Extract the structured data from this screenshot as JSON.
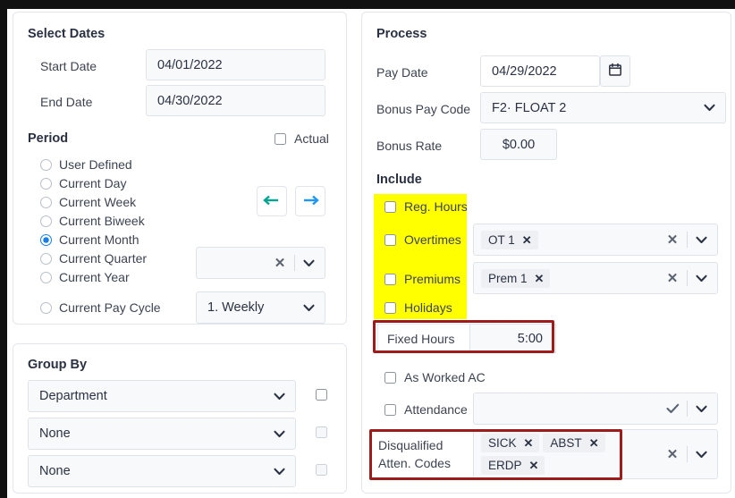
{
  "left": {
    "select_dates": {
      "title": "Select Dates",
      "start_date": {
        "label": "Start Date",
        "value": "04/01/2022"
      },
      "end_date": {
        "label": "End Date",
        "value": "04/30/2022"
      },
      "period": {
        "title": "Period",
        "actual": {
          "label": "Actual",
          "checked": false
        },
        "options": [
          {
            "label": "User Defined",
            "selected": false
          },
          {
            "label": "Current Day",
            "selected": false
          },
          {
            "label": "Current Week",
            "selected": false
          },
          {
            "label": "Current Biweek",
            "selected": false
          },
          {
            "label": "Current Month",
            "selected": true
          },
          {
            "label": "Current Quarter",
            "selected": false
          },
          {
            "label": "Current Year",
            "selected": false
          },
          {
            "label": "Current Pay Cycle",
            "selected": false
          }
        ],
        "nav": {
          "prev_icon": "arrow-left-icon",
          "next_icon": "arrow-right-icon"
        },
        "quarter_select": {
          "value": ""
        },
        "pay_cycle_select": {
          "value": "1. Weekly"
        }
      }
    },
    "group_by": {
      "title": "Group By",
      "rows": [
        {
          "value": "Department",
          "checked": false,
          "disabled": false
        },
        {
          "value": "None",
          "checked": false,
          "disabled": true
        },
        {
          "value": "None",
          "checked": false,
          "disabled": true
        }
      ]
    }
  },
  "right": {
    "process": {
      "title": "Process",
      "pay_date": {
        "label": "Pay Date",
        "value": "04/29/2022",
        "icon": "calendar-icon"
      },
      "bonus_pay_code": {
        "label": "Bonus Pay Code",
        "value": "F2· FLOAT 2"
      },
      "bonus_rate": {
        "label": "Bonus Rate",
        "value": "$0.00"
      },
      "include": {
        "title": "Include",
        "items": [
          {
            "label": "Reg. Hours",
            "checked": false
          },
          {
            "label": "Overtimes",
            "checked": false
          },
          {
            "label": "Premiums",
            "checked": false
          },
          {
            "label": "Holidays",
            "checked": false
          }
        ],
        "overtimes_tags": [
          "OT 1"
        ],
        "premiums_tags": [
          "Prem 1"
        ]
      },
      "fixed_hours": {
        "label": "Fixed Hours",
        "value": "5:00"
      },
      "as_worked_ac": {
        "label": "As Worked AC",
        "checked": false
      },
      "attendance": {
        "label": "Attendance",
        "checked": false,
        "value": ""
      },
      "disqualified": {
        "label_line1": "Disqualified",
        "label_line2": "Atten. Codes",
        "tags": [
          "SICK",
          "ABST",
          "ERDP"
        ]
      }
    }
  },
  "colors": {
    "highlight": "#ffff00",
    "annotation": "#9e1b1b",
    "radio_selected": "#1a7ee8",
    "arrow_prev": "#00a48f",
    "arrow_next": "#2196f3"
  }
}
